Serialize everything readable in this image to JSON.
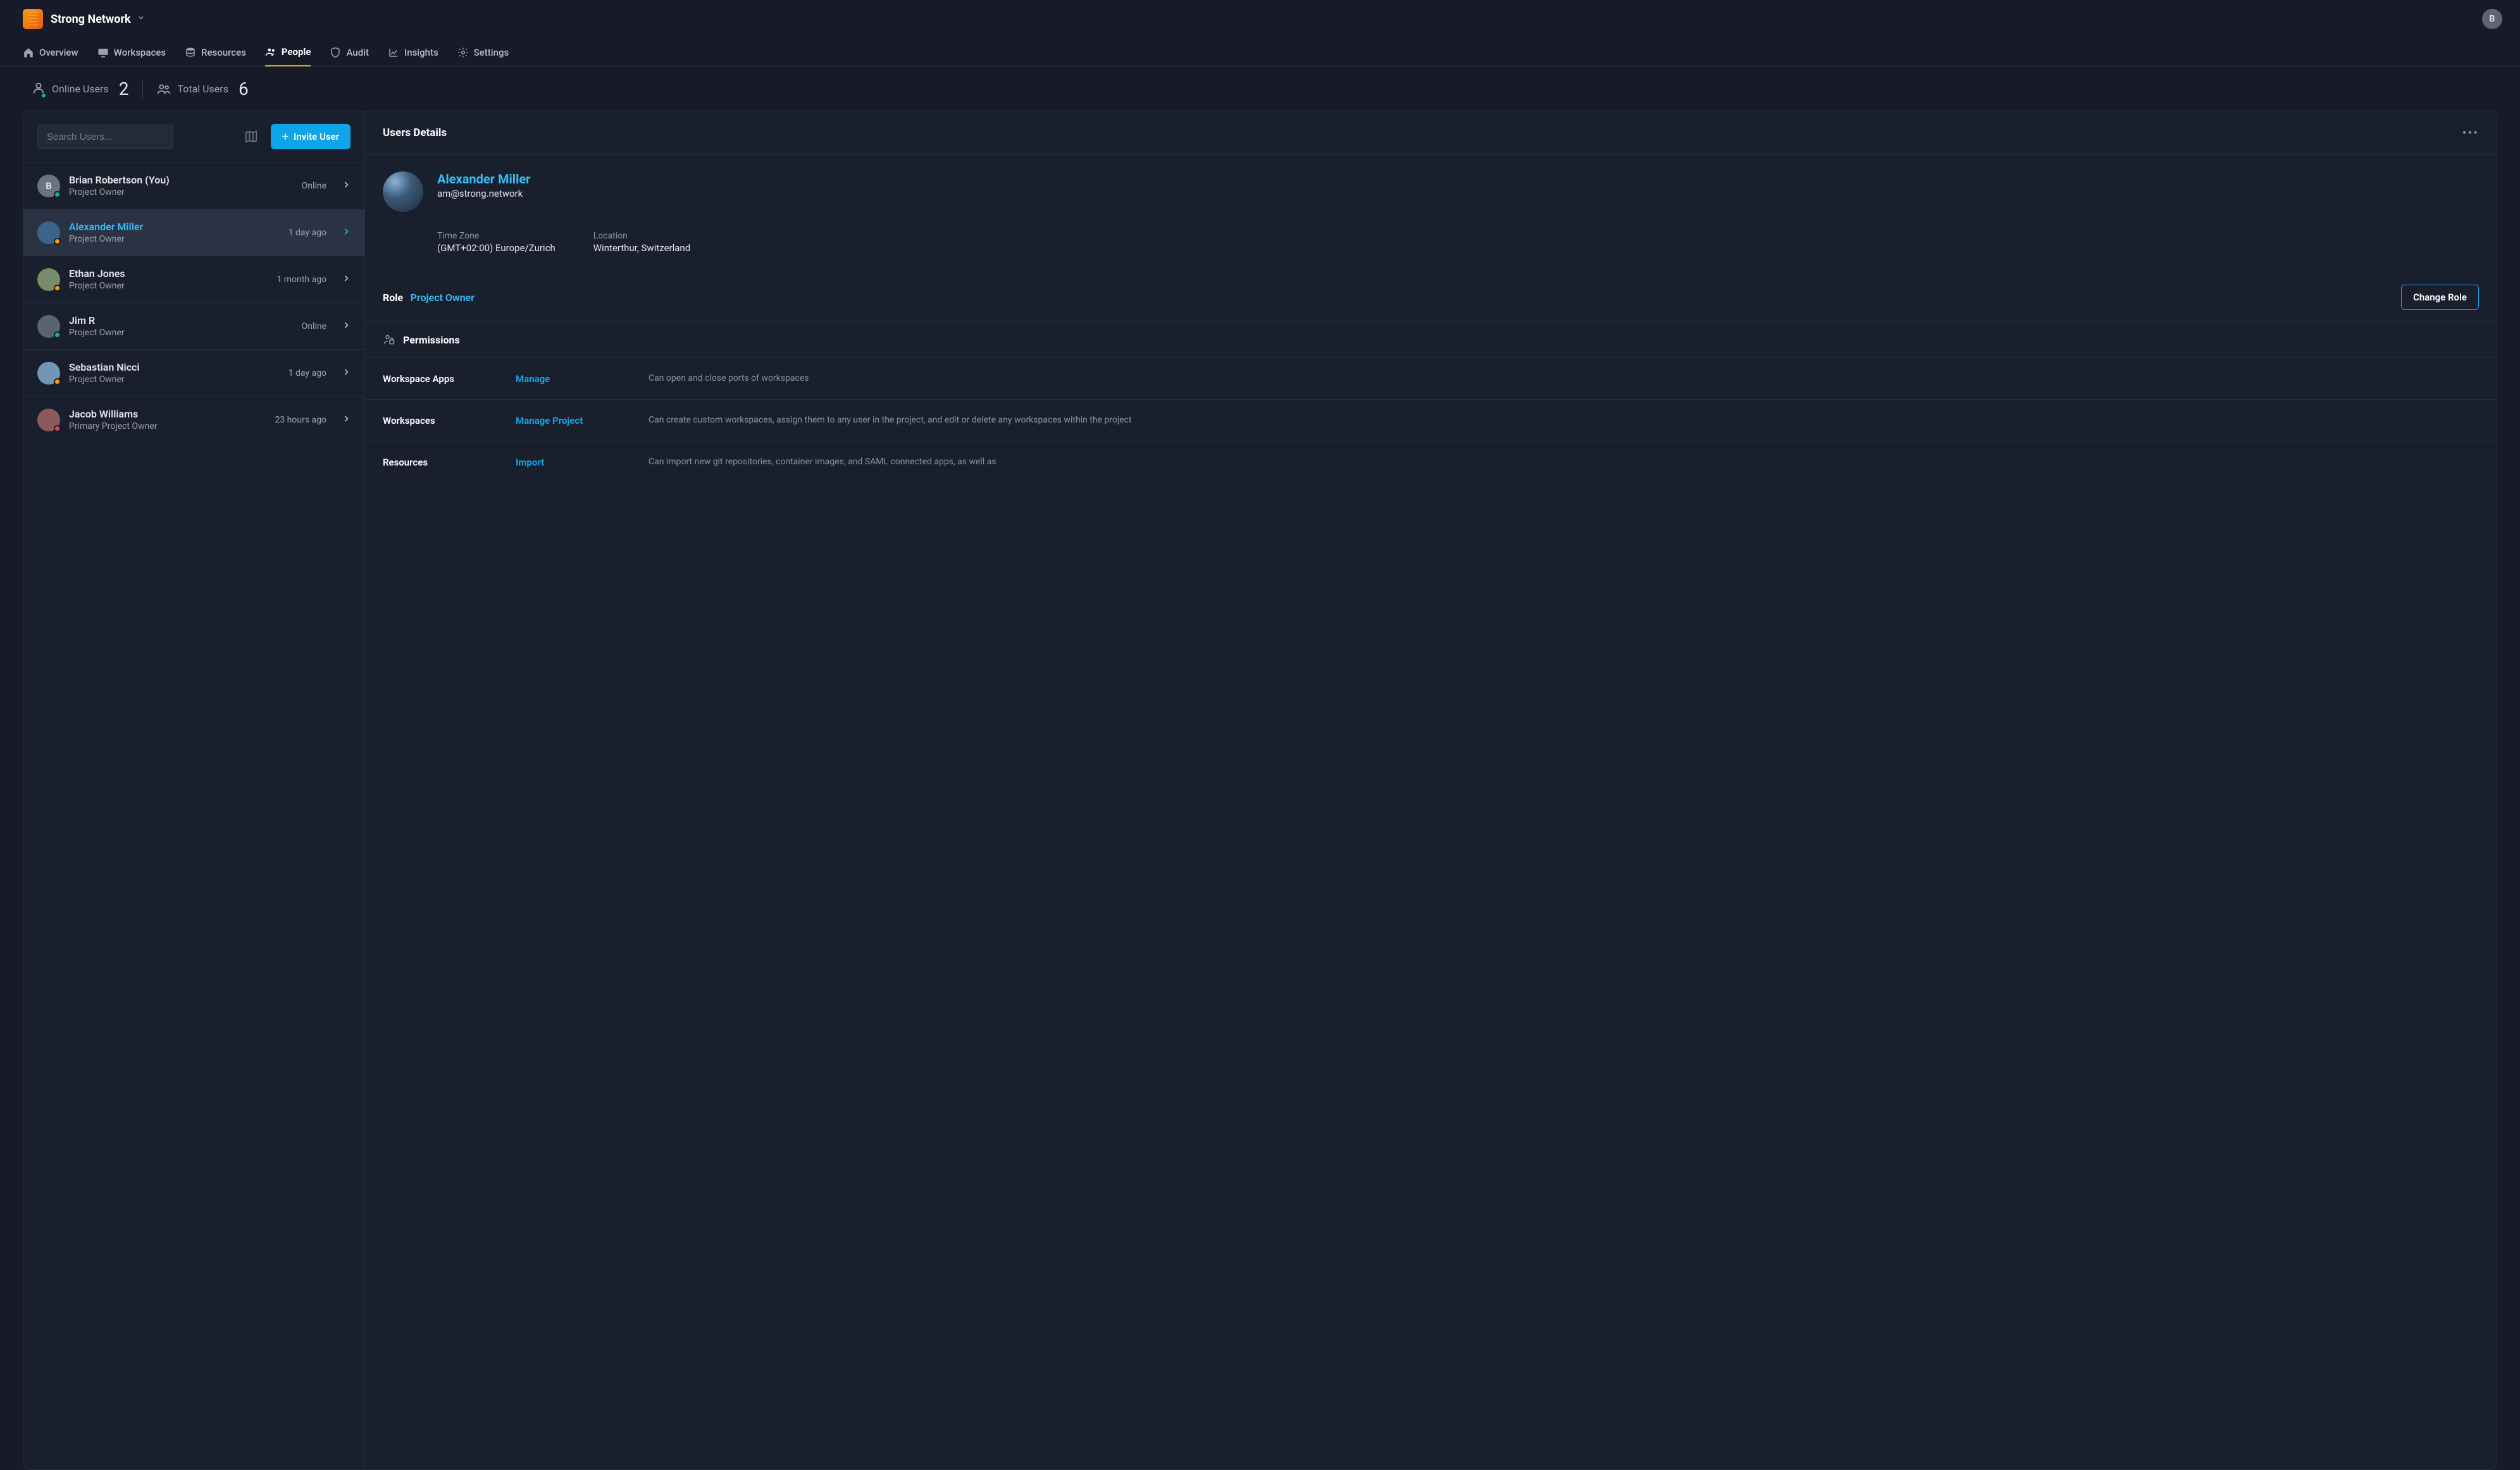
{
  "header": {
    "app_title": "Strong Network",
    "avatar_initial": "B"
  },
  "tabs": [
    {
      "id": "overview",
      "label": "Overview",
      "icon": "home"
    },
    {
      "id": "workspaces",
      "label": "Workspaces",
      "icon": "monitor"
    },
    {
      "id": "resources",
      "label": "Resources",
      "icon": "database"
    },
    {
      "id": "people",
      "label": "People",
      "icon": "users",
      "active": true
    },
    {
      "id": "audit",
      "label": "Audit",
      "icon": "shield"
    },
    {
      "id": "insights",
      "label": "Insights",
      "icon": "chart"
    },
    {
      "id": "settings",
      "label": "Settings",
      "icon": "gear"
    }
  ],
  "stats": {
    "online_label": "Online Users",
    "online_value": "2",
    "total_label": "Total Users",
    "total_value": "6"
  },
  "left": {
    "search_placeholder": "Search Users...",
    "invite_label": "Invite User"
  },
  "users": [
    {
      "name": "Brian Robertson (You)",
      "role": "Project Owner",
      "meta": "Online",
      "initial": "B",
      "presence": "online",
      "selected": false,
      "color": "#6B7280"
    },
    {
      "name": "Alexander Miller",
      "role": "Project Owner",
      "meta": "1 day ago",
      "initial": "",
      "presence": "away",
      "selected": true,
      "color": "#3B648C"
    },
    {
      "name": "Ethan Jones",
      "role": "Project Owner",
      "meta": "1 month ago",
      "initial": "",
      "presence": "away",
      "selected": false,
      "color": "#7A8B6A"
    },
    {
      "name": "Jim R",
      "role": "Project Owner",
      "meta": "Online",
      "initial": "",
      "presence": "online",
      "selected": false,
      "color": "#5A6470"
    },
    {
      "name": "Sebastian Nicci",
      "role": "Project Owner",
      "meta": "1 day ago",
      "initial": "",
      "presence": "away",
      "selected": false,
      "color": "#7396B8"
    },
    {
      "name": "Jacob Williams",
      "role": "Primary Project Owner",
      "meta": "23 hours ago",
      "initial": "",
      "presence": "busy",
      "selected": false,
      "color": "#8C5A5A"
    }
  ],
  "detail": {
    "header": "Users Details",
    "name": "Alexander Miller",
    "email": "am@strong.network",
    "timezone_label": "Time Zone",
    "timezone": "(GMT+02:00) Europe/Zurich",
    "location_label": "Location",
    "location": "Winterthur, Switzerland",
    "role_label": "Role",
    "role_value": "Project Owner",
    "change_role": "Change Role",
    "permissions_label": "Permissions",
    "permissions": [
      {
        "name": "Workspace Apps",
        "level": "Manage",
        "desc": "Can open and close ports of workspaces"
      },
      {
        "name": "Workspaces",
        "level": "Manage Project",
        "desc": "Can create custom workspaces, assign them to any user in the project, and edit or delete any workspaces within the project"
      },
      {
        "name": "Resources",
        "level": "Import",
        "desc": "Can import new git repositories, container images, and SAML connected apps, as well as"
      }
    ]
  }
}
